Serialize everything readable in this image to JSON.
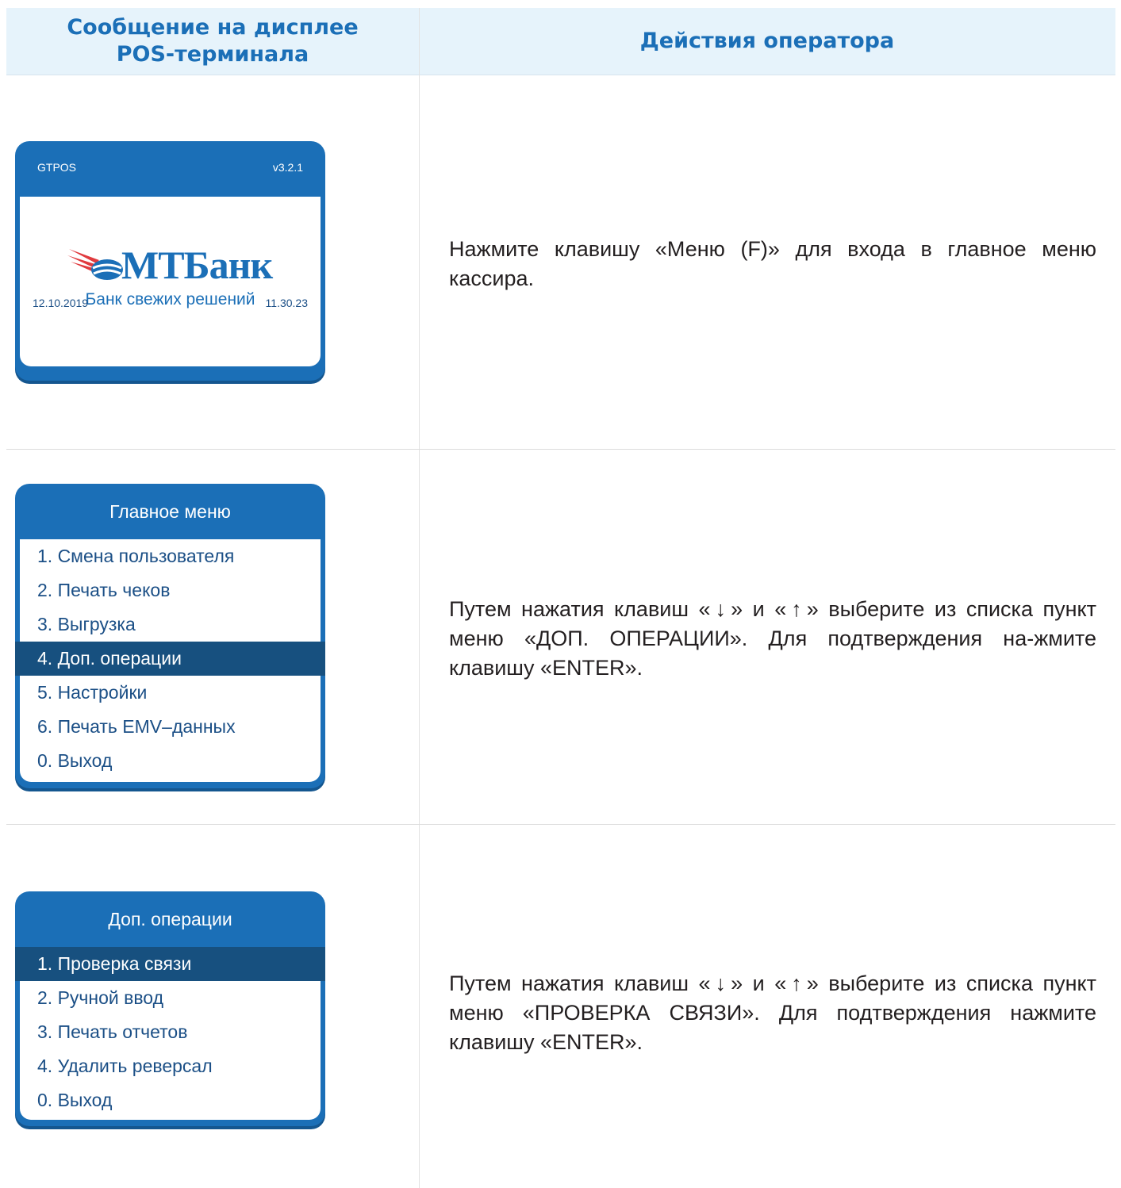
{
  "header": {
    "display_col": "Сообщение на дисплее\nPOS-терминала",
    "actions_col": "Действия оператора"
  },
  "screen1": {
    "app_name": "GTPOS",
    "version": "v3.2.1",
    "logo_text": "МТБанк",
    "slogan": "Банк свежих решений",
    "date": "12.10.2019",
    "time": "11.30.23"
  },
  "screen2": {
    "title": "Главное меню",
    "items": [
      "1. Смена пользователя",
      "2. Печать чеков",
      "3. Выгрузка",
      "4. Доп. операции",
      "5. Настройки",
      "6. Печать EMV–данных",
      "0. Выход"
    ],
    "selected_index": 3
  },
  "screen3": {
    "title": "Доп. операции",
    "items": [
      "1. Проверка связи",
      "2. Ручной ввод",
      "3. Печать отчетов",
      "4. Удалить реверсал",
      "0. Выход"
    ],
    "selected_index": 0
  },
  "instructions": {
    "step1": "Нажмите клавишу «Меню (F)» для входа в главное меню кассира.",
    "step2_a": "Путем нажатия клавиш «",
    "step2_b": "» и «",
    "step2_c": "» выберите из списка пункт меню «ДОП. ОПЕРАЦИИ». Для подтверждения на-жмите клавишу «ENTER».",
    "step3_a": "Путем нажатия клавиш «",
    "step3_b": "» и «",
    "step3_c": "» выберите из списка пункт меню «ПРОВЕРКА СВЯЗИ». Для подтверждения нажмите клавишу «ENTER».",
    "arrow_down": "↓",
    "arrow_up": "↑"
  },
  "colors": {
    "brand_blue": "#1b6fb7",
    "selected_row": "#17507f",
    "header_bg": "#e6f3fb",
    "logo_red": "#e03a3e"
  }
}
